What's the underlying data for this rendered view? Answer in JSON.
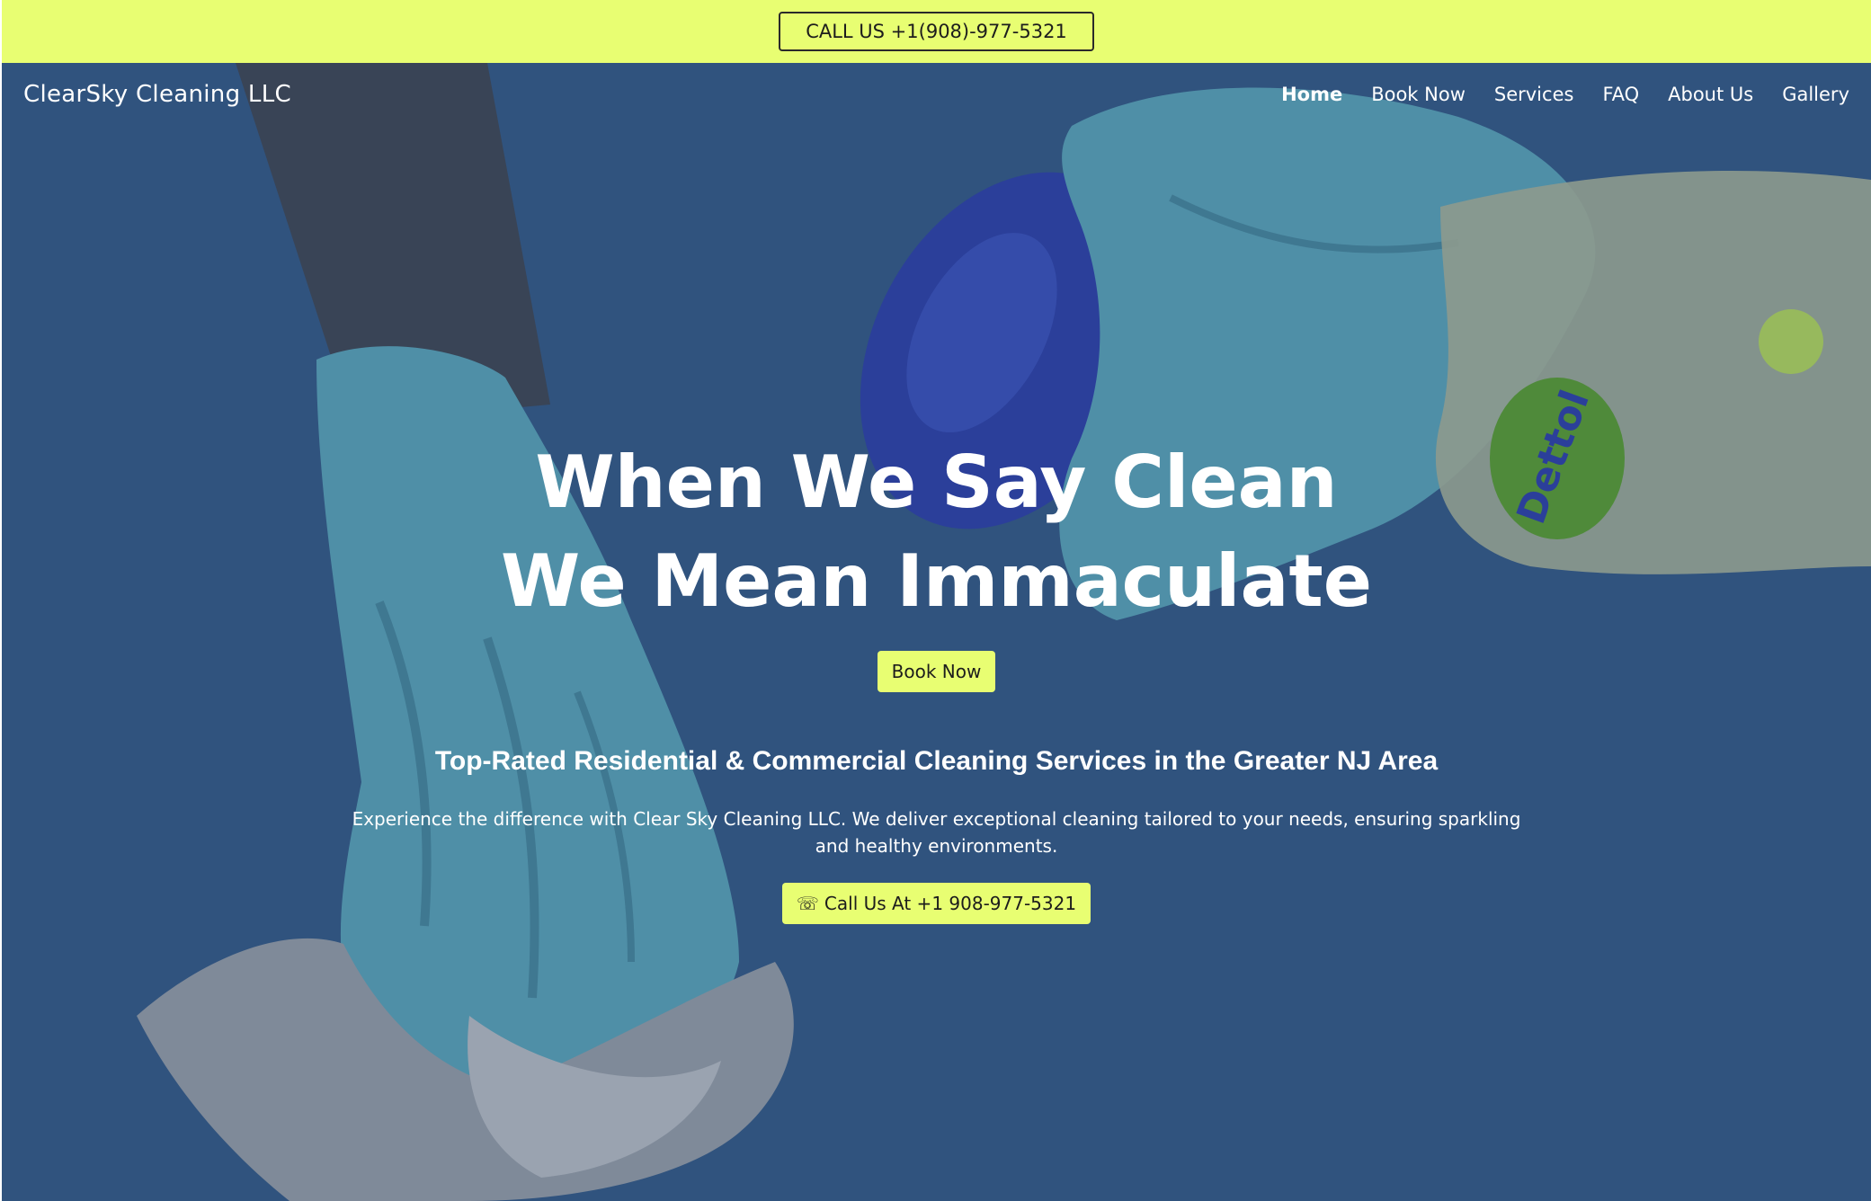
{
  "topbar": {
    "call_label": "CALL US +1(908)-977-5321"
  },
  "header": {
    "brand": "ClearSky Cleaning LLC",
    "nav": [
      {
        "label": "Home",
        "active": true
      },
      {
        "label": "Book Now"
      },
      {
        "label": "Services"
      },
      {
        "label": "FAQ"
      },
      {
        "label": "About Us"
      },
      {
        "label": "Gallery"
      }
    ]
  },
  "hero": {
    "headline_line1": "When We Say Clean",
    "headline_line2": "We Mean Immaculate",
    "book_label": "Book Now",
    "subheading": "Top-Rated Residential & Commercial Cleaning Services in the Greater NJ Area",
    "description": "Experience the difference with Clear Sky Cleaning LLC. We deliver exceptional cleaning tailored to your needs, ensuring sparkling and healthy environments.",
    "phone_icon": "☏",
    "phone_label": "Call Us At +1 908-977-5321",
    "bottle_brand": "Dettol"
  },
  "colors": {
    "accent": "#e8fe72",
    "hero_bg": "#30537e",
    "text": "#ffffff"
  }
}
